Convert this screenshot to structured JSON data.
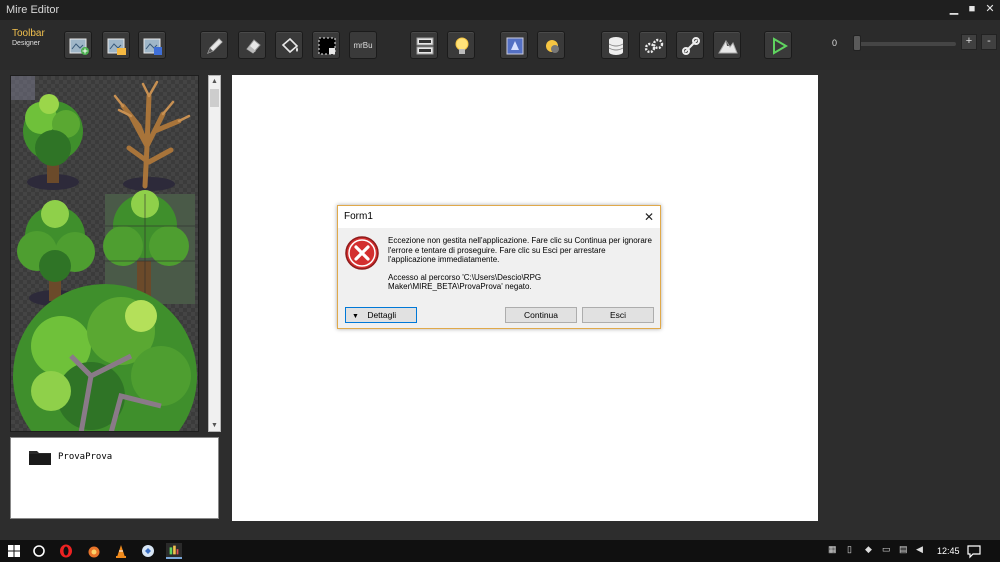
{
  "window": {
    "title": "Mire Editor",
    "controls": [
      "minimize-icon",
      "maximize-icon",
      "close-icon"
    ]
  },
  "toolbar": {
    "brand_line1": "Toolbar",
    "brand_line2": "Designer",
    "text_button": "mrBu",
    "buttons": [
      "new-map-icon",
      "edit-map-icon",
      "map-settings-icon",
      "pencil-icon",
      "eraser-icon",
      "fill-bucket-icon",
      "selection-icon",
      "layers-icon",
      "light-bulb-icon",
      "event-icon",
      "sun-icon",
      "database-icon",
      "gears-icon",
      "link-icon",
      "terrain-icon",
      "play-icon"
    ],
    "zoom_value": "0",
    "zoom_plus": "+",
    "zoom_minus": "-"
  },
  "project": {
    "name": "ProvaProva"
  },
  "dialog": {
    "title": "Form1",
    "message1": "Eccezione non gestita nell'applicazione. Fare clic su Continua per ignorare l'errore e tentare di proseguire. Fare clic su Esci per arrestare l'applicazione immediatamente.",
    "message2": "Accesso al percorso 'C:\\Users\\Descio\\RPG Maker\\MIRE_BETA\\ProvaProva' negato.",
    "details_button": "Dettagli",
    "continue_button": "Continua",
    "exit_button": "Esci"
  },
  "taskbar": {
    "clock": "12:45"
  },
  "colors": {
    "accent": "#f2c14e",
    "dialog_border": "#e0a94a",
    "error_red": "#d32f2f",
    "play_green": "#5fd35f"
  }
}
